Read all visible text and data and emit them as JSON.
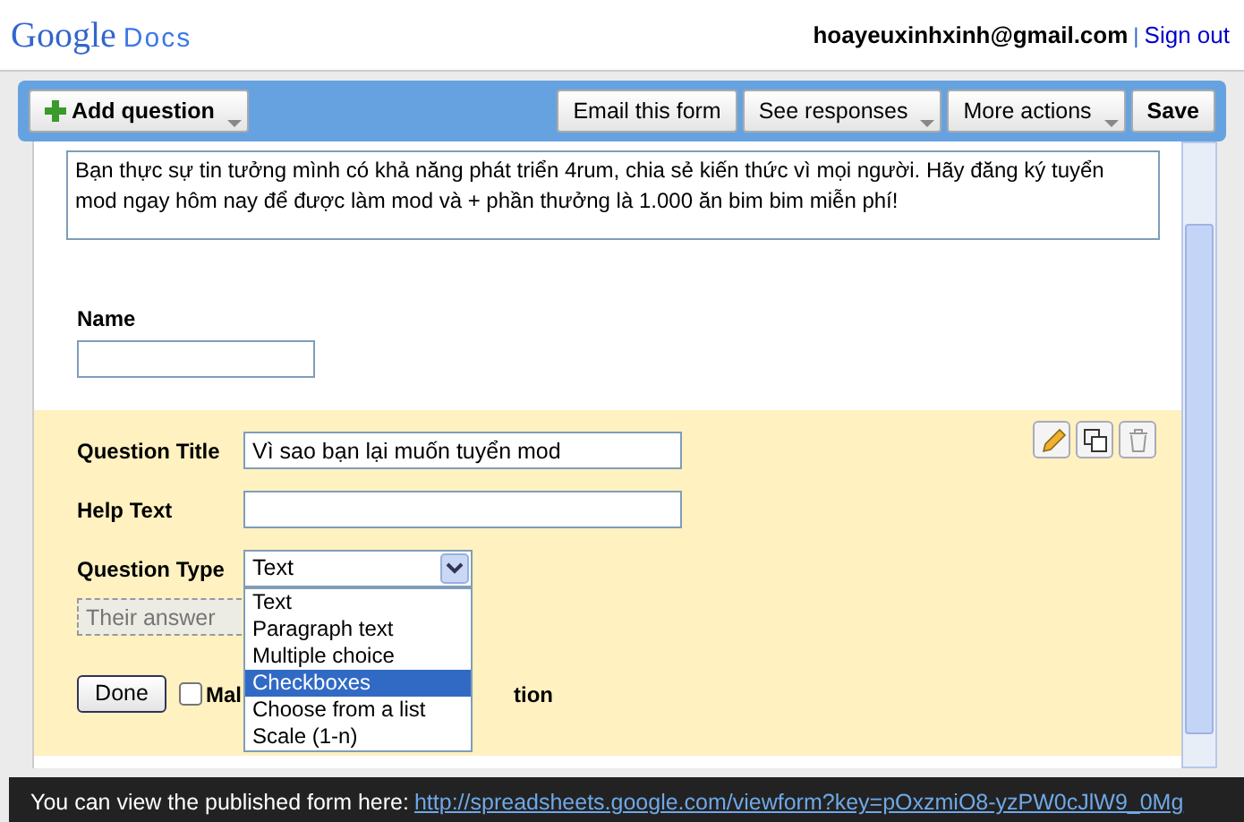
{
  "header": {
    "logo_word": "Google",
    "logo_product": "Docs",
    "account": "hoayeuxinhxinh@gmail.com",
    "separator": "|",
    "sign_out": "Sign out"
  },
  "toolbar": {
    "add_question": "Add question",
    "buttons": [
      {
        "label": "Email this form",
        "dropdown": false
      },
      {
        "label": "See responses",
        "dropdown": true
      },
      {
        "label": "More actions",
        "dropdown": true
      }
    ],
    "save": "Save"
  },
  "form": {
    "description": "Bạn thực sự tin tưởng mình có khả năng phát triển 4rum, chia sẻ kiến thức vì mọi người. Hãy đăng ký tuyển mod ngay hôm nay để được làm mod và + phần thưởng là 1.000 ăn bim bim miễn phí!",
    "questions": [
      {
        "title": "Name"
      }
    ],
    "editor": {
      "title_label": "Question Title",
      "title_value": "Vì sao bạn lại muốn tuyển mod",
      "help_label": "Help Text",
      "type_label": "Question Type",
      "type_value": "Text",
      "type_options": [
        {
          "label": "Text",
          "selected": false
        },
        {
          "label": "Paragraph text",
          "selected": false
        },
        {
          "label": "Multiple choice",
          "selected": false
        },
        {
          "label": "Checkboxes",
          "selected": true
        },
        {
          "label": "Choose from a list",
          "selected": false
        },
        {
          "label": "Scale (1-n)",
          "selected": false
        }
      ],
      "answer_placeholder": "Their answer",
      "done": "Done",
      "required": {
        "checked": false,
        "label_start": "Mal",
        "label_end": "tion"
      }
    }
  },
  "status_bar": {
    "text": "You can view the published form here:",
    "link": "http://spreadsheets.google.com/viewform?key=pOxzmiO8-yzPW0cJlW9_0Mg"
  }
}
